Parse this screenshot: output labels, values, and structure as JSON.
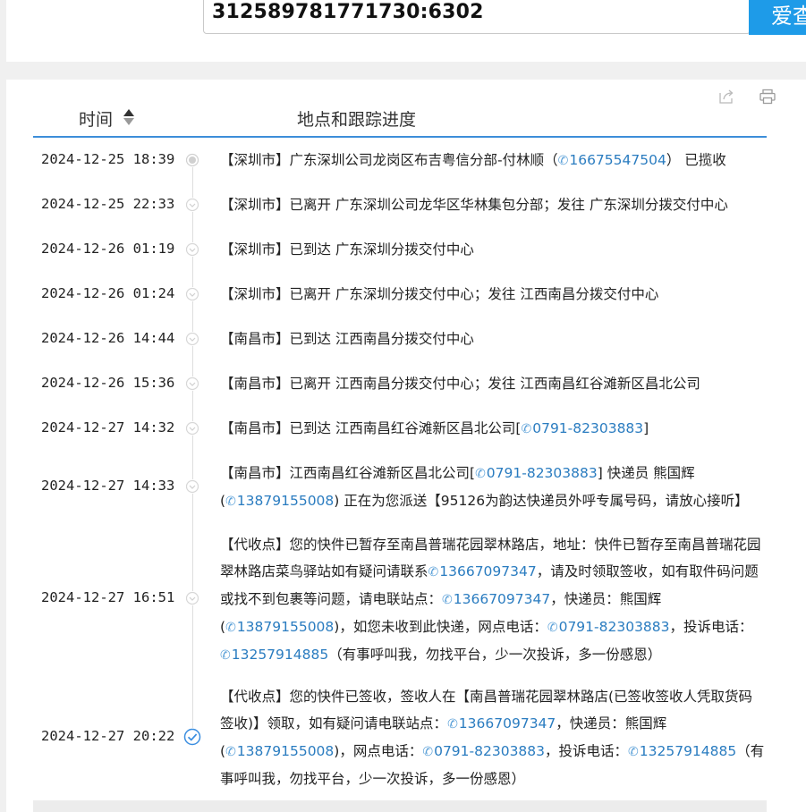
{
  "query": {
    "value": "312589781771730:6302",
    "button_label": "爱查"
  },
  "table": {
    "time_header": "时间",
    "progress_header": "地点和跟踪进度",
    "rows": [
      {
        "time": "2024-12-25 18:39",
        "parts": [
          {
            "t": "【深圳市】广东深圳公司龙岗区布吉粤信分部-付林顺（"
          },
          {
            "p": "16675547504"
          },
          {
            "t": "） 已揽收"
          }
        ]
      },
      {
        "time": "2024-12-25 22:33",
        "parts": [
          {
            "t": "【深圳市】已离开 广东深圳公司龙华区华林集包分部；发往 广东深圳分拨交付中心"
          }
        ]
      },
      {
        "time": "2024-12-26 01:19",
        "parts": [
          {
            "t": "【深圳市】已到达 广东深圳分拨交付中心"
          }
        ]
      },
      {
        "time": "2024-12-26 01:24",
        "parts": [
          {
            "t": "【深圳市】已离开 广东深圳分拨交付中心；发往 江西南昌分拨交付中心"
          }
        ]
      },
      {
        "time": "2024-12-26 14:44",
        "parts": [
          {
            "t": "【南昌市】已到达 江西南昌分拨交付中心"
          }
        ]
      },
      {
        "time": "2024-12-26 15:36",
        "parts": [
          {
            "t": "【南昌市】已离开 江西南昌分拨交付中心；发往 江西南昌红谷滩新区昌北公司"
          }
        ]
      },
      {
        "time": "2024-12-27 14:32",
        "parts": [
          {
            "t": "【南昌市】已到达 江西南昌红谷滩新区昌北公司["
          },
          {
            "p": "0791-82303883"
          },
          {
            "t": "]"
          }
        ]
      },
      {
        "time": "2024-12-27 14:33",
        "parts": [
          {
            "t": "【南昌市】江西南昌红谷滩新区昌北公司["
          },
          {
            "p": "0791-82303883"
          },
          {
            "t": "] 快递员 熊国辉 ("
          },
          {
            "p": "13879155008"
          },
          {
            "t": ") 正在为您派送【95126为韵达快递员外呼专属号码，请放心接听】"
          }
        ]
      },
      {
        "time": "2024-12-27 16:51",
        "parts": [
          {
            "t": "【代收点】您的快件已暂存至南昌普瑞花园翠林路店，地址：快件已暂存至南昌普瑞花园翠林路店菜鸟驿站如有疑问请联系"
          },
          {
            "p": "13667097347"
          },
          {
            "t": "，请及时领取签收，如有取件码问题或找不到包裹等问题，请电联站点："
          },
          {
            "p": "13667097347"
          },
          {
            "t": "，快递员：熊国辉 ("
          },
          {
            "p": "13879155008"
          },
          {
            "t": ")，如您未收到此快递，网点电话："
          },
          {
            "p": "0791-82303883"
          },
          {
            "t": "，投诉电话："
          },
          {
            "p": "13257914885"
          },
          {
            "t": "（有事呼叫我，勿找平台，少一次投诉，多一份感恩）"
          }
        ]
      },
      {
        "time": "2024-12-27 20:22",
        "parts": [
          {
            "t": "【代收点】您的快件已签收，签收人在【南昌普瑞花园翠林路店(已签收签收人凭取货码签收)】领取，如有疑问请电联站点："
          },
          {
            "p": "13667097347"
          },
          {
            "t": "，快递员：熊国辉 ("
          },
          {
            "p": "13879155008"
          },
          {
            "t": ")，网点电话："
          },
          {
            "p": "0791-82303883"
          },
          {
            "t": "，投诉电话："
          },
          {
            "p": "13257914885"
          },
          {
            "t": "（有事呼叫我，勿找平台，少一次投诉，多一份感恩）"
          }
        ]
      }
    ]
  },
  "icons": {
    "share": "share-icon",
    "print": "print-icon",
    "sort": "sort-icon",
    "phone": "phone-icon",
    "timeline_dot": "chevron-down-circle-icon",
    "delivered": "check-circle-icon"
  },
  "colors": {
    "accent": "#1e9be8",
    "link": "#2a7cc0",
    "header_line": "#3d8ed9"
  }
}
